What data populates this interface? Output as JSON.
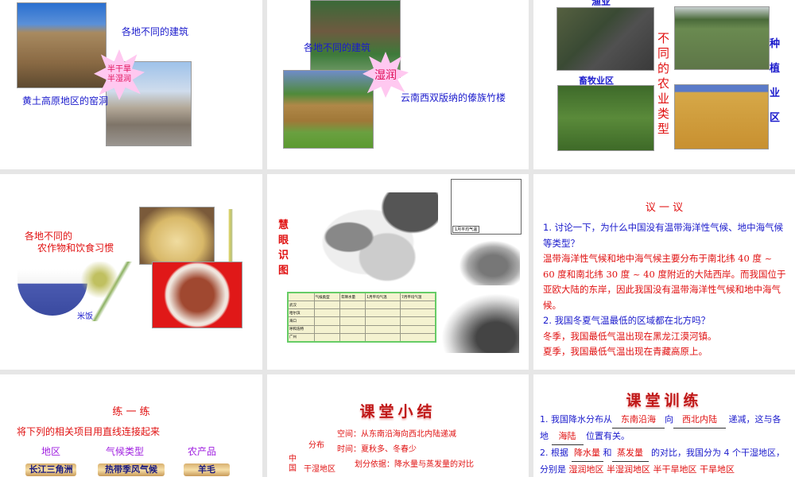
{
  "slides": {
    "s1": {
      "title": "各地不同的建筑",
      "caption": "黄土高原地区的窑洞",
      "burst": [
        "半干旱",
        "半湿润"
      ]
    },
    "s2": {
      "title": "各地不同的建筑",
      "caption": "云南西双版纳的傣族竹楼",
      "burst": "湿润"
    },
    "s3": {
      "top_label": "渔业",
      "pastoral_label": "畜牧业区",
      "vertical_title": "不同的农业类型",
      "planting_label": [
        "种",
        "植",
        "业",
        "区"
      ]
    },
    "s4": {
      "line1": "各地不同的",
      "line2": "农作物和饮食习惯",
      "rice_label": "米饭"
    },
    "s5": {
      "vertical_title": "慧眼识图",
      "map_caption": "1月平均气温",
      "table_headers": [
        "",
        "气候类型",
        "年降水量",
        "1月平均气温",
        "7月平均气温"
      ],
      "table_rows": [
        "武汉",
        "哈尔滨",
        "海口",
        "呼和浩特",
        "广州"
      ]
    },
    "s6": {
      "title": "议 一 议",
      "q1": "1. 讨论一下，为什么中国没有温带海洋性气候、地中海气候等类型？",
      "a1": "温带海洋性气候和地中海气候主要分布于南北纬 40 度 ~ 60 度和南北纬 30 度 ~ 40 度附近的大陆西岸。而我国位于亚欧大陆的东岸，因此我国没有温带海洋性气候和地中海气候。",
      "q2": "2. 我国冬夏气温最低的区域都在北方吗？",
      "a2a": "冬季，我国最低气温出现在黑龙江漠河镇。",
      "a2b": "夏季，我国最低气温出现在青藏高原上。"
    },
    "s7": {
      "title": "练 一 练",
      "instruction": "将下列的相关项目用直线连接起来",
      "headers": [
        "地区",
        "气候类型",
        "农产品"
      ],
      "items": [
        "长江三角洲",
        "热带季风气候",
        "羊毛"
      ]
    },
    "s8": {
      "title": "课堂小结",
      "dist": "分布",
      "space": "空间：从东南沿海向西北内陆递减",
      "time": "时间：夏秋多、冬春少",
      "china": "中国",
      "basis": "划分依据：降水量与蒸发量的对比",
      "region": "干湿地区"
    },
    "s9": {
      "title": "课堂训练",
      "q1a": "1. 我国降水分布从",
      "b1": "东南沿海",
      "q1b": "向",
      "b2": "西北内陆",
      "q1c": "递减，这与各",
      "q1d": "地",
      "b3": "海陆",
      "q1e": "位置有关。",
      "q2a": "2. 根据",
      "b4": "降水量",
      "q2b": "和",
      "b5": "蒸发量",
      "q2c": "的对比，我国分为 4 个干湿地区，",
      "q2d": "分别是",
      "ans": [
        "湿润地区",
        "半湿润地区",
        "半干旱地区",
        "干旱地区"
      ]
    }
  }
}
